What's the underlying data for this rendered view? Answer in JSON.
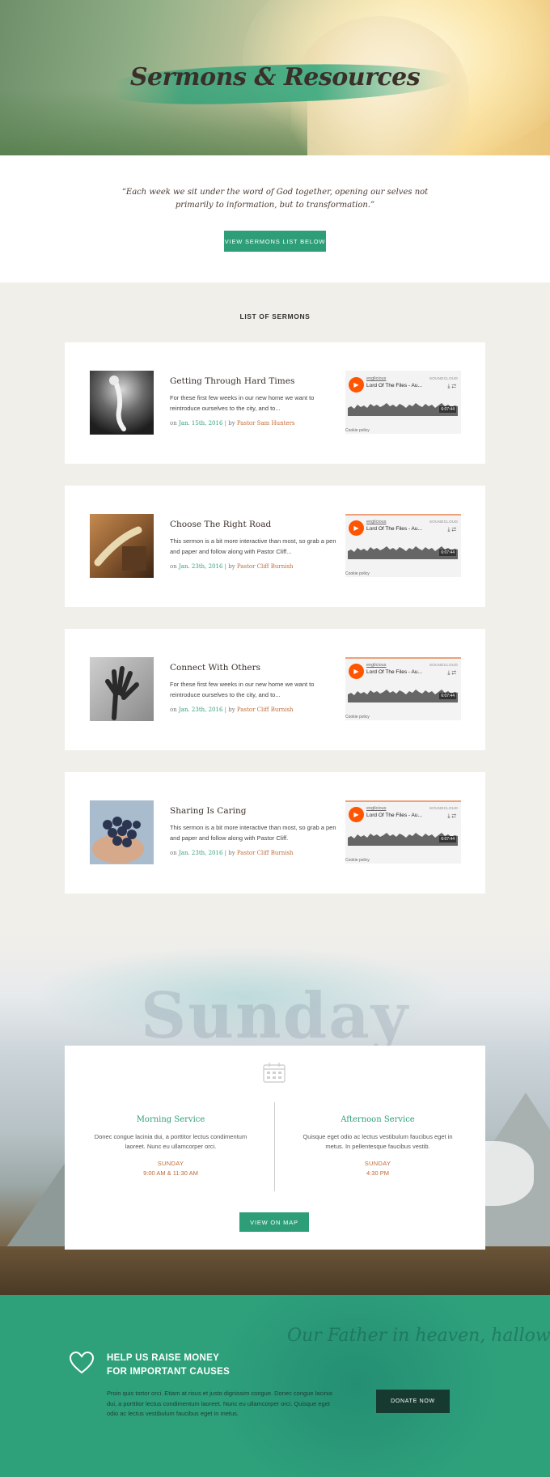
{
  "hero": {
    "title": "Sermons & Resources"
  },
  "intro": {
    "quote": "“Each week we sit under the word of God together, opening our selves not primarily to information, but to transformation.”",
    "button_label": "VIEW SERMONS LIST BELOW"
  },
  "sermons_heading": "LIST OF SERMONS",
  "sermons": [
    {
      "title": "Getting Through Hard Times",
      "description": "For these first few weeks in our new home we want to reintroduce ourselves to the city, and to...",
      "prefix": "on",
      "date": "Jan. 15th, 2016",
      "separator": "| by",
      "author": "Pastor Sam Hunters",
      "player": {
        "artist": "englicious",
        "track": "Lord Of The Files - Au...",
        "brand": "SOUNDCLOUD",
        "duration": "6:07:44",
        "cookie": "Cookie policy"
      }
    },
    {
      "title": "Choose The Right Road",
      "description": "This sermon is a bit more interactive than most, so grab a pen and paper and follow along with Pastor Cliff...",
      "prefix": "on",
      "date": "Jan. 23th, 2016",
      "separator": "| by",
      "author": "Pastor Cliff Burnish",
      "player": {
        "artist": "englicious",
        "track": "Lord Of The Files - Au...",
        "brand": "SOUNDCLOUD",
        "duration": "6:07:44",
        "cookie": "Cookie policy"
      }
    },
    {
      "title": "Connect With Others",
      "description": "For these first few weeks in our new home we want to reintroduce ourselves to the city, and to...",
      "prefix": "on",
      "date": "Jan. 23th, 2016",
      "separator": "| by",
      "author": "Pastor Cliff Burnish",
      "player": {
        "artist": "englicious",
        "track": "Lord Of The Files - Au...",
        "brand": "SOUNDCLOUD",
        "duration": "6:07:44",
        "cookie": "Cookie policy"
      }
    },
    {
      "title": "Sharing Is Caring",
      "description": "This sermon is a bit more interactive than most, so grab a pen and paper and follow along with Pastor Cliff.",
      "prefix": "on",
      "date": "Jan. 23th, 2016",
      "separator": "| by",
      "author": "Pastor Cliff Burnish",
      "player": {
        "artist": "englicious",
        "track": "Lord Of The Files - Au...",
        "brand": "SOUNDCLOUD",
        "duration": "6:07:44",
        "cookie": "Cookie policy"
      }
    }
  ],
  "services": {
    "background_word": "Sunday",
    "calendar_icon": "calendar-icon",
    "morning": {
      "name": "Morning Service",
      "description": "Donec congue lacinia dui, a porttitor lectus condimentum laoreet. Nunc eu ullamcorper orci.",
      "day": "SUNDAY",
      "time": "9:00 AM & 11:30 AM"
    },
    "afternoon": {
      "name": "Afternoon Service",
      "description": "Quisque eget odio ac lectus vestibulum faucibus eget in metus. In pellentesque faucibus vestib.",
      "day": "SUNDAY",
      "time": "4:30 PM"
    },
    "map_button": "VIEW ON MAP"
  },
  "donate": {
    "script_text": "Our Father in heaven, hallowed be your",
    "title_line1": "HELP US RAISE MONEY",
    "title_line2": "FOR IMPORTANT CAUSES",
    "text": "Proin quis tortor orci. Etiam at risus et justo dignissim congue. Donec congue lacinia dui, a porttitor lectus condimentum laoreet. Nunc eu ullamcorper orci. Quisque eget odio ac lectus vestibulum faucibus eget in metus.",
    "button_label": "DONATE NOW",
    "icon": "heart-icon"
  },
  "colors": {
    "accent": "#2e9e78",
    "author": "#c06a35",
    "soundcloud": "#ff5500",
    "donate_bg": "#2ea17b",
    "dark_button": "#173a30"
  }
}
